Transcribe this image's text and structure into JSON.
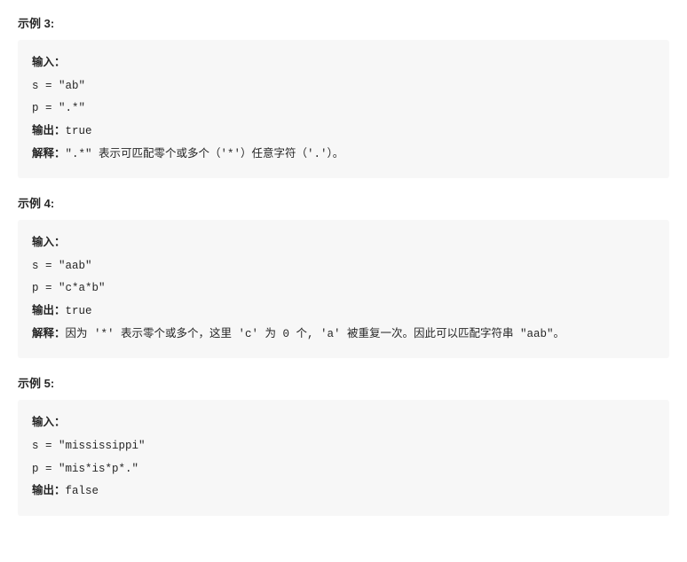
{
  "labels": {
    "input": "输入：",
    "output": "输出：",
    "explain": "解释："
  },
  "examples": [
    {
      "title": "示例 3:",
      "s": "s = \"ab\"",
      "p": "p = \".*\"",
      "output": "true",
      "explain": "\".*\" 表示可匹配零个或多个（'*'）任意字符（'.'）。"
    },
    {
      "title": "示例 4:",
      "s": "s = \"aab\"",
      "p": "p = \"c*a*b\"",
      "output": "true",
      "explain": "因为 '*' 表示零个或多个，这里 'c' 为 0 个, 'a' 被重复一次。因此可以匹配字符串 \"aab\"。"
    },
    {
      "title": "示例 5:",
      "s": "s = \"mississippi\"",
      "p": "p = \"mis*is*p*.\"",
      "output": "false",
      "explain": null
    }
  ]
}
